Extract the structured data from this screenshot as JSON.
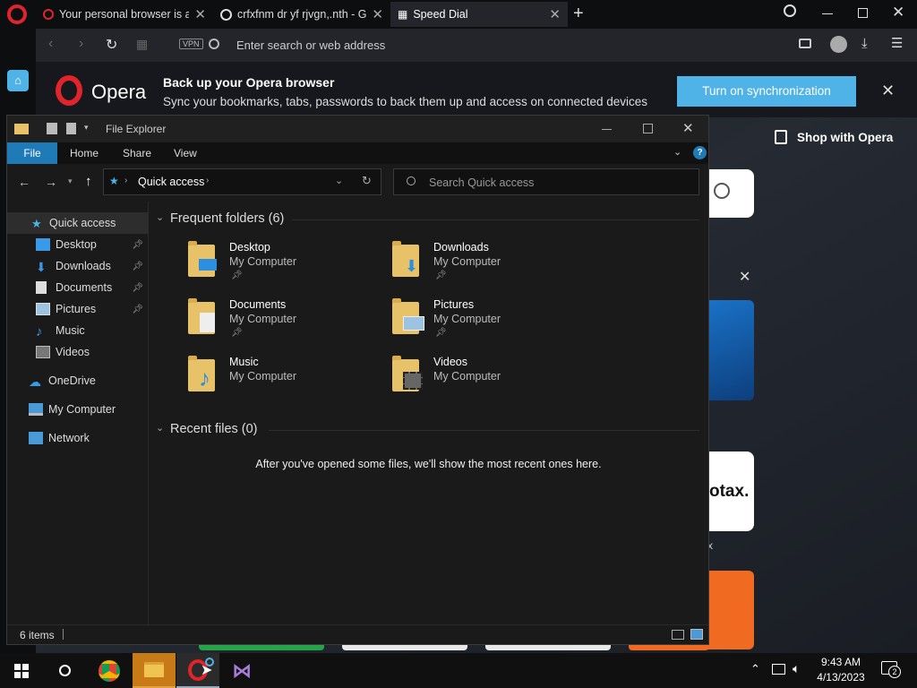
{
  "browser": {
    "tabs": [
      {
        "title": "Your personal browser is al",
        "icon": "opera-icon"
      },
      {
        "title": "crfxfnm dr yf rjvgn,.nth - G",
        "icon": "google-icon"
      },
      {
        "title": "Speed Dial",
        "icon": "grid-icon"
      }
    ],
    "address_placeholder": "Enter search or web address",
    "vpn_label": "VPN",
    "opera_word": "Opera"
  },
  "sync_banner": {
    "title": "Back up your Opera browser",
    "subtitle": "Sync your bookmarks, tabs, passwords to back them up and access on connected devices",
    "button": "Turn on synchronization"
  },
  "speed_dial": {
    "shop_label": "Shop with Opera",
    "partial_tax": "otax.",
    "partial_x": "x"
  },
  "explorer": {
    "title": "File Explorer",
    "menu": [
      "File",
      "Home",
      "Share",
      "View"
    ],
    "breadcrumb": "Quick access",
    "search_placeholder": "Search Quick access",
    "nav": [
      {
        "label": "Quick access",
        "icon": "star-icon"
      },
      {
        "label": "Desktop",
        "icon": "desktop-icon",
        "pinned": true
      },
      {
        "label": "Downloads",
        "icon": "download-icon",
        "pinned": true
      },
      {
        "label": "Documents",
        "icon": "document-icon",
        "pinned": true
      },
      {
        "label": "Pictures",
        "icon": "picture-icon",
        "pinned": true
      },
      {
        "label": "Music",
        "icon": "music-icon"
      },
      {
        "label": "Videos",
        "icon": "video-icon"
      },
      {
        "label": "OneDrive",
        "icon": "cloud-icon"
      },
      {
        "label": "My Computer",
        "icon": "computer-icon"
      },
      {
        "label": "Network",
        "icon": "network-icon"
      }
    ],
    "frequent_header": "Frequent folders (6)",
    "folders": [
      {
        "name": "Desktop",
        "location": "My Computer",
        "pinned": true
      },
      {
        "name": "Downloads",
        "location": "My Computer",
        "pinned": true
      },
      {
        "name": "Documents",
        "location": "My Computer",
        "pinned": true
      },
      {
        "name": "Pictures",
        "location": "My Computer",
        "pinned": true
      },
      {
        "name": "Music",
        "location": "My Computer",
        "pinned": false
      },
      {
        "name": "Videos",
        "location": "My Computer",
        "pinned": false
      }
    ],
    "recent_header": "Recent files (0)",
    "recent_empty": "After you've opened some files, we'll show the most recent ones here.",
    "status_items": "6 items"
  },
  "taskbar": {
    "time": "9:43 AM",
    "date": "4/13/2023",
    "notification_count": "2"
  },
  "colors": {
    "accent_blue": "#4fb3e8",
    "opera_red": "#e0242b",
    "file_tab": "#1e7bb8"
  }
}
